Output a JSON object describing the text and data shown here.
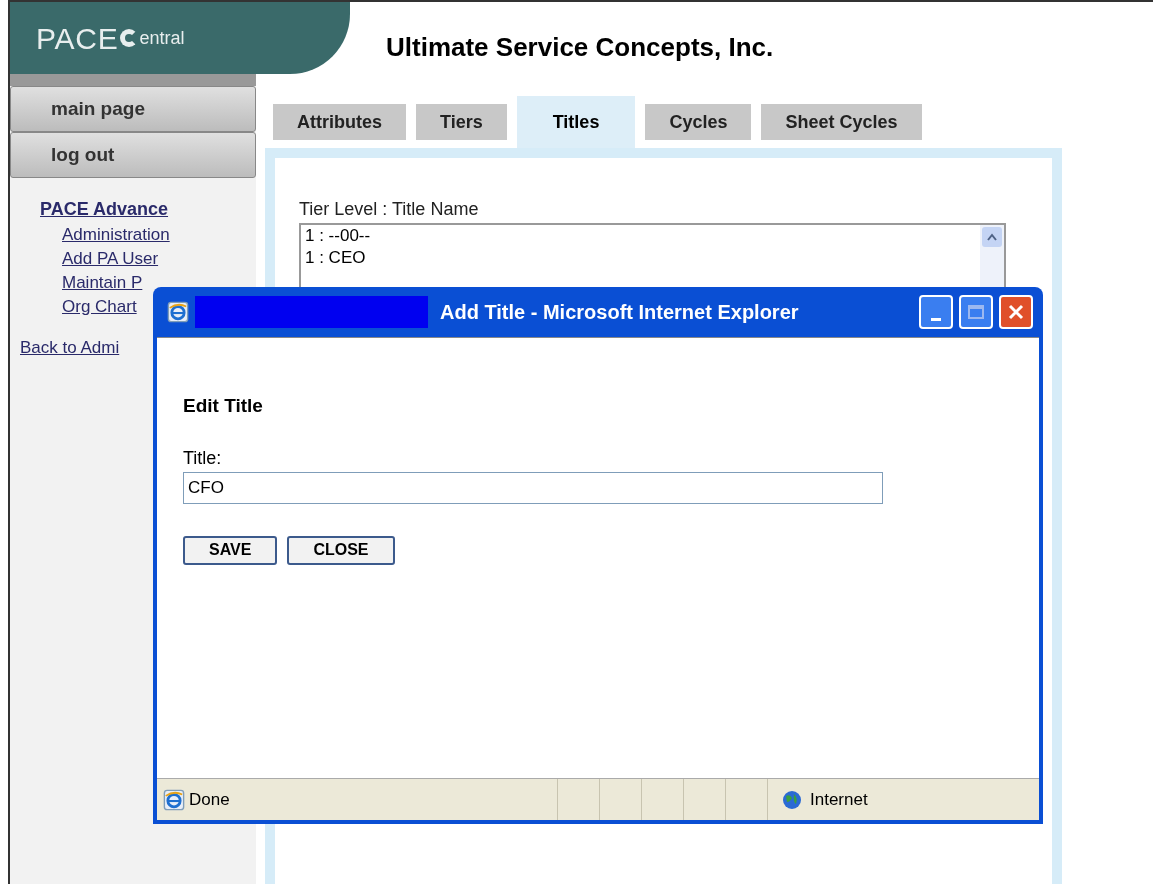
{
  "header": {
    "logo_text": "PACE",
    "logo_suffix": "entral",
    "company": "Ultimate Service Concepts, Inc."
  },
  "sidebar": {
    "buttons": [
      "main page",
      "log out"
    ],
    "section": "PACE Advance",
    "links": [
      "Administration",
      "Add PA User",
      "Maintain P",
      "Org Chart"
    ],
    "back_link": "Back to Admi"
  },
  "tabs": [
    {
      "label": "Attributes",
      "selected": false
    },
    {
      "label": "Tiers",
      "selected": false
    },
    {
      "label": "Titles",
      "selected": true
    },
    {
      "label": "Cycles",
      "selected": false
    },
    {
      "label": "Sheet Cycles",
      "selected": false
    }
  ],
  "list": {
    "label": "Tier Level : Title Name",
    "items": [
      "1 : --00--",
      "1 : CEO"
    ]
  },
  "popup": {
    "title": "Add Title - Microsoft Internet Explorer",
    "heading": "Edit Title",
    "field_label": "Title:",
    "field_value": "CFO",
    "buttons": [
      "SAVE",
      "CLOSE"
    ],
    "status": "Done",
    "zone": "Internet"
  }
}
